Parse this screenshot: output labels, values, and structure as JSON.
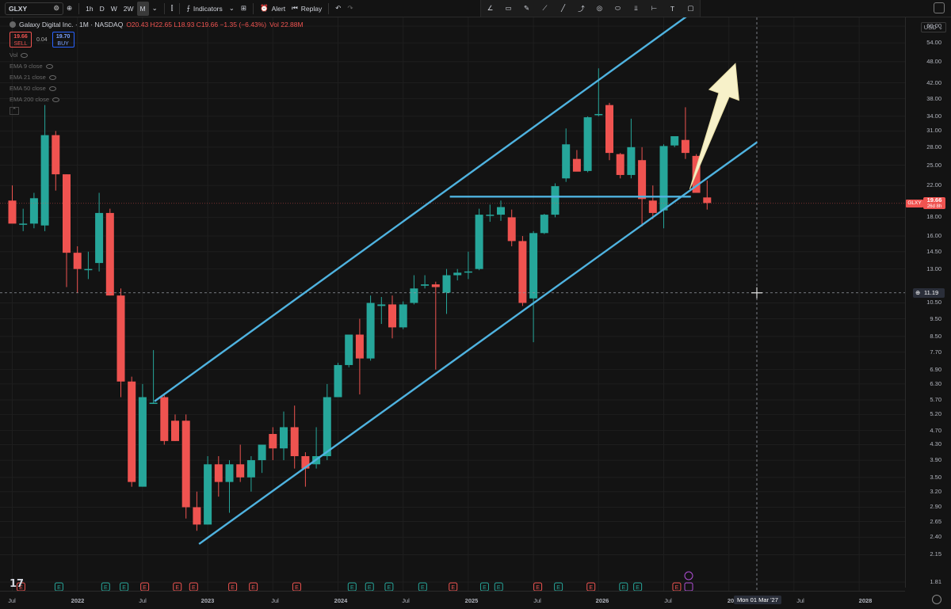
{
  "toolbar": {
    "symbol": "GLXY",
    "timeframes": [
      "1h",
      "D",
      "W",
      "2W",
      "M"
    ],
    "active_timeframe": "M",
    "indicators_label": "Indicators",
    "alert_label": "Alert",
    "replay_label": "Replay"
  },
  "legend": {
    "title": "Galaxy Digital Inc. · 1M · NASDAQ",
    "ohlc": "O20.43 H22.65 L18.93 C19.66 −1.35 (−6.43%)",
    "volume": "Vol 22.88M",
    "sell_price": "19.66",
    "sell_label": "SELL",
    "spread": "0.04",
    "buy_price": "19.70",
    "buy_label": "BUY",
    "indicators": [
      "Vol",
      "EMA 9 close",
      "EMA 21 close",
      "EMA 50 close",
      "EMA 200 close"
    ]
  },
  "price_scale": {
    "currency": "USD",
    "ticks": [
      "60.00",
      "54.00",
      "48.00",
      "42.00",
      "38.00",
      "34.00",
      "31.00",
      "28.00",
      "25.00",
      "22.00",
      "18.00",
      "16.00",
      "14.50",
      "13.00",
      "10.50",
      "9.50",
      "8.50",
      "7.70",
      "6.90",
      "6.30",
      "5.70",
      "5.20",
      "4.70",
      "4.30",
      "3.90",
      "3.50",
      "3.20",
      "2.90",
      "2.65",
      "2.40",
      "2.15",
      "1.81"
    ],
    "last_symbol": "GLXY",
    "last_price": "19.66",
    "last_countdown": "26d 8h",
    "crosshair_price": "11.19"
  },
  "time_axis": {
    "labels": [
      "Jul",
      "2022",
      "Jul",
      "2023",
      "Jul",
      "2024",
      "Jul",
      "2025",
      "Jul",
      "2026",
      "Jul",
      "20",
      "Jul",
      "2028"
    ],
    "crosshair_date": "Mon 01 Mar '27"
  },
  "colors": {
    "up": "#26a69a",
    "down": "#ef5350",
    "channel": "#4fb3e0",
    "arrow": "#f7f1c9"
  },
  "chart_data": {
    "type": "candlestick",
    "symbol": "GLXY",
    "interval": "1M",
    "y_scale": "log",
    "ylim": [
      1.81,
      60.0
    ],
    "series": [
      {
        "o": 20,
        "h": 22,
        "l": 18,
        "c": 17.3
      },
      {
        "o": 17.3,
        "h": 19.0,
        "l": 16.5,
        "c": 17.3
      },
      {
        "o": 17.3,
        "h": 21.0,
        "l": 16.8,
        "c": 20.3
      },
      {
        "o": 17.1,
        "h": 36.5,
        "l": 16.5,
        "c": 30.2
      },
      {
        "o": 30.2,
        "h": 31.0,
        "l": 21.3,
        "c": 23.6
      },
      {
        "o": 23.6,
        "h": 23.6,
        "l": 11.6,
        "c": 14.4
      },
      {
        "o": 14.4,
        "h": 15.0,
        "l": 11.2,
        "c": 13.0
      },
      {
        "o": 13.0,
        "h": 14.5,
        "l": 12.2,
        "c": 13.0
      },
      {
        "o": 13.5,
        "h": 21.0,
        "l": 12.8,
        "c": 18.5
      },
      {
        "o": 18.5,
        "h": 19.0,
        "l": 11.0,
        "c": 11.0
      },
      {
        "o": 11.0,
        "h": 11.5,
        "l": 5.8,
        "c": 6.4
      },
      {
        "o": 6.4,
        "h": 6.6,
        "l": 3.3,
        "c": 3.4
      },
      {
        "o": 3.3,
        "h": 6.3,
        "l": 3.3,
        "c": 5.8
      },
      {
        "o": 5.6,
        "h": 7.8,
        "l": 5.6,
        "c": 5.6
      },
      {
        "o": 5.8,
        "h": 5.9,
        "l": 4.3,
        "c": 4.4
      },
      {
        "o": 5.0,
        "h": 5.2,
        "l": 4.4,
        "c": 4.4
      },
      {
        "o": 5.0,
        "h": 5.2,
        "l": 2.7,
        "c": 2.9
      },
      {
        "o": 2.9,
        "h": 3.2,
        "l": 2.5,
        "c": 2.6
      },
      {
        "o": 2.6,
        "h": 4.0,
        "l": 2.6,
        "c": 3.8
      },
      {
        "o": 3.8,
        "h": 4.0,
        "l": 3.1,
        "c": 3.4
      },
      {
        "o": 3.4,
        "h": 3.9,
        "l": 2.8,
        "c": 3.8
      },
      {
        "o": 3.8,
        "h": 4.3,
        "l": 3.4,
        "c": 3.5
      },
      {
        "o": 3.5,
        "h": 4.0,
        "l": 3.2,
        "c": 3.9
      },
      {
        "o": 3.9,
        "h": 4.3,
        "l": 3.6,
        "c": 4.3
      },
      {
        "o": 4.6,
        "h": 4.8,
        "l": 3.9,
        "c": 4.2
      },
      {
        "o": 4.2,
        "h": 5.3,
        "l": 3.9,
        "c": 4.8
      },
      {
        "o": 4.8,
        "h": 5.5,
        "l": 3.7,
        "c": 4.0
      },
      {
        "o": 4.0,
        "h": 4.1,
        "l": 3.3,
        "c": 3.7
      },
      {
        "o": 3.8,
        "h": 4.8,
        "l": 3.7,
        "c": 4.0
      },
      {
        "o": 4.0,
        "h": 6.3,
        "l": 3.9,
        "c": 5.8
      },
      {
        "o": 5.8,
        "h": 7.2,
        "l": 5.8,
        "c": 7.1
      },
      {
        "o": 7.1,
        "h": 8.6,
        "l": 7.0,
        "c": 8.6
      },
      {
        "o": 8.6,
        "h": 9.5,
        "l": 5.9,
        "c": 7.4
      },
      {
        "o": 7.4,
        "h": 11.0,
        "l": 7.3,
        "c": 10.5
      },
      {
        "o": 10.3,
        "h": 10.9,
        "l": 9.2,
        "c": 10.4
      },
      {
        "o": 10.4,
        "h": 11.0,
        "l": 8.4,
        "c": 9.0
      },
      {
        "o": 9.0,
        "h": 10.6,
        "l": 8.9,
        "c": 10.4
      },
      {
        "o": 10.5,
        "h": 12.5,
        "l": 10.4,
        "c": 11.5
      },
      {
        "o": 11.7,
        "h": 12.5,
        "l": 11.5,
        "c": 11.8
      },
      {
        "o": 11.8,
        "h": 12.0,
        "l": 6.9,
        "c": 11.6
      },
      {
        "o": 11.2,
        "h": 13.0,
        "l": 9.8,
        "c": 12.5
      },
      {
        "o": 12.5,
        "h": 13.0,
        "l": 12.1,
        "c": 12.7
      },
      {
        "o": 12.8,
        "h": 14.5,
        "l": 12.2,
        "c": 12.8
      },
      {
        "o": 13.0,
        "h": 19.0,
        "l": 12.9,
        "c": 18.3
      },
      {
        "o": 18.3,
        "h": 19.5,
        "l": 17.5,
        "c": 18.3
      },
      {
        "o": 18.3,
        "h": 20.0,
        "l": 17.6,
        "c": 19.2
      },
      {
        "o": 18.0,
        "h": 18.9,
        "l": 15.0,
        "c": 15.5
      },
      {
        "o": 15.5,
        "h": 16.0,
        "l": 10.3,
        "c": 10.5
      },
      {
        "o": 10.8,
        "h": 16.5,
        "l": 8.2,
        "c": 16.3
      },
      {
        "o": 16.3,
        "h": 18.4,
        "l": 16.2,
        "c": 18.3
      },
      {
        "o": 18.3,
        "h": 22.3,
        "l": 18.0,
        "c": 21.9
      },
      {
        "o": 23.0,
        "h": 31.5,
        "l": 22.5,
        "c": 28.5
      },
      {
        "o": 26.0,
        "h": 27.5,
        "l": 24.6,
        "c": 24.0
      },
      {
        "o": 24.1,
        "h": 34.0,
        "l": 23.9,
        "c": 33.8
      },
      {
        "o": 34.5,
        "h": 46.0,
        "l": 34.0,
        "c": 34.5
      },
      {
        "o": 36.5,
        "h": 37.0,
        "l": 25.8,
        "c": 27.0
      },
      {
        "o": 26.8,
        "h": 27.0,
        "l": 23.0,
        "c": 23.5
      },
      {
        "o": 23.5,
        "h": 33.5,
        "l": 23.0,
        "c": 28.0
      },
      {
        "o": 25.8,
        "h": 28.0,
        "l": 17.0,
        "c": 20.2
      },
      {
        "o": 20.0,
        "h": 22.0,
        "l": 17.8,
        "c": 18.5
      },
      {
        "o": 18.8,
        "h": 28.5,
        "l": 16.8,
        "c": 28.2
      },
      {
        "o": 28.3,
        "h": 30.0,
        "l": 28.0,
        "c": 30.0
      },
      {
        "o": 29.3,
        "h": 36.0,
        "l": 26.0,
        "c": 27.0
      },
      {
        "o": 26.5,
        "h": 26.8,
        "l": 21.0,
        "c": 21.0
      },
      {
        "o": 20.4,
        "h": 22.7,
        "l": 18.9,
        "c": 19.7
      }
    ]
  }
}
